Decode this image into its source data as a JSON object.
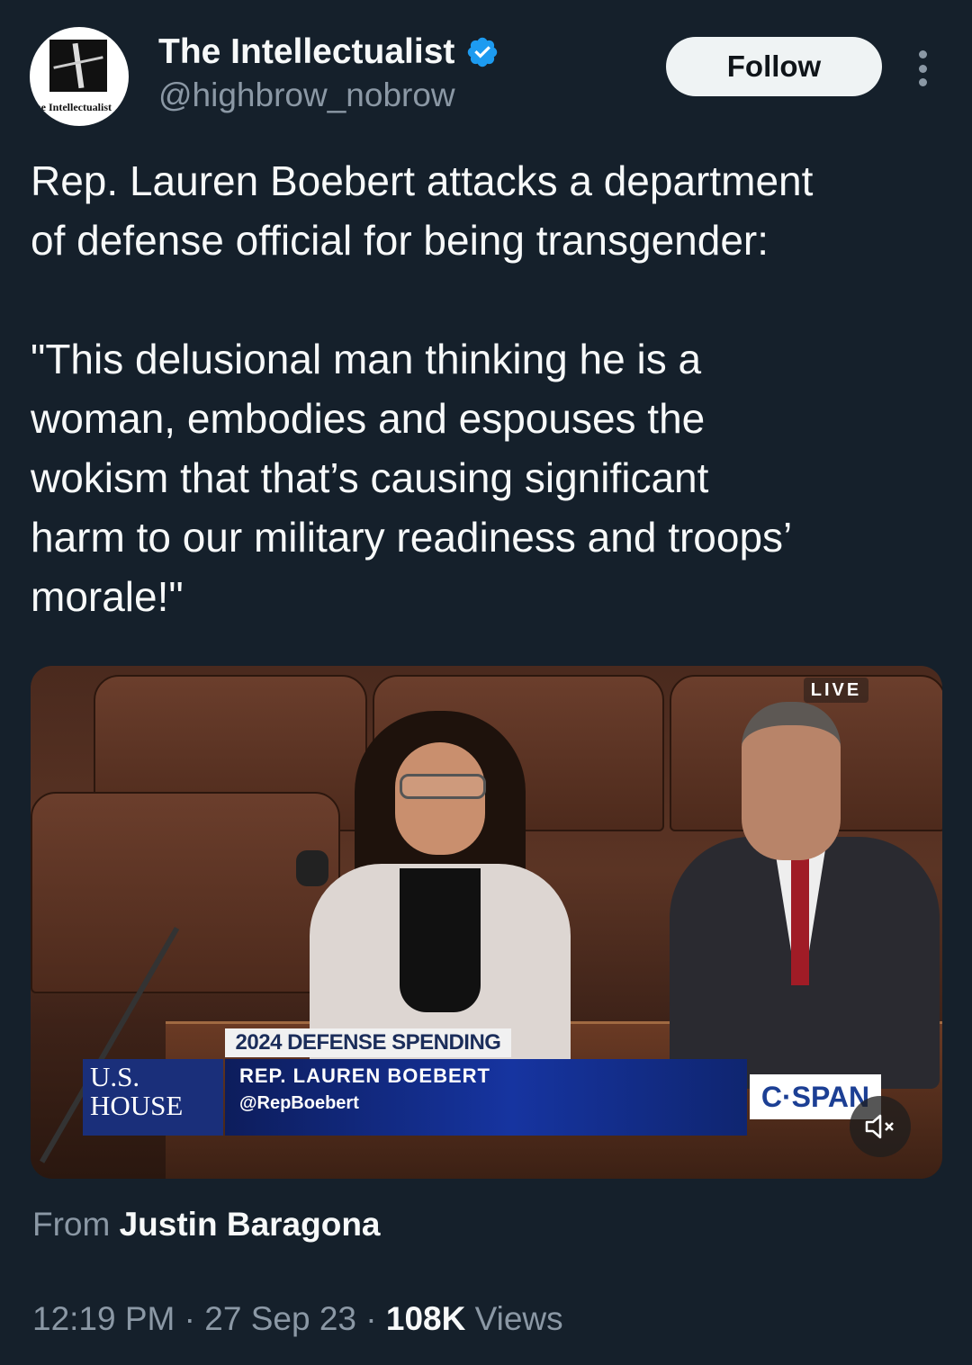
{
  "author": {
    "display_name": "The Intellectualist",
    "handle": "@highbrow_nobrow",
    "avatar_text": "The Intellectualist",
    "verified_icon": "verified-badge-icon",
    "verified_color": "#1d9bf0"
  },
  "actions": {
    "follow_label": "Follow",
    "more_icon": "more-options-icon"
  },
  "tweet": {
    "text": "Rep. Lauren Boebert attacks a department\nof defense official for being transgender:\n\n\"This delusional man thinking he is a\nwoman, embodies and espouses the\nwokism that that’s causing significant\nharm to our military readiness and troops’\nmorale!\""
  },
  "media": {
    "live_label": "LIVE",
    "chyron_title": "2024 DEFENSE SPENDING",
    "chyron_name": "REP. LAUREN BOEBERT",
    "chyron_handle": "@RepBoebert",
    "house_logo_line1": "U.S.",
    "house_logo_line2": "HOUSE",
    "network_logo": "C·SPAN",
    "mute_icon": "muted-speaker-icon"
  },
  "attribution": {
    "from_label": "From",
    "from_name": "Justin Baragona"
  },
  "meta": {
    "time": "12:19 PM",
    "sep1": "·",
    "date": "27 Sep 23",
    "sep2": "·",
    "views_count": "108K",
    "views_label": "Views"
  },
  "colors": {
    "background": "#15202b",
    "secondary_text": "#8b98a5",
    "primary_text": "#f7f9f9",
    "follow_bg": "#eff3f4"
  }
}
